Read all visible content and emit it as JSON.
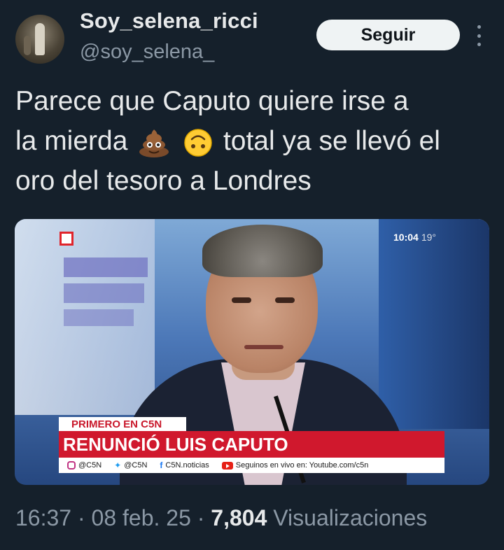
{
  "user": {
    "display_name": "Soy_selena_ricci",
    "handle": "@soy_selena_"
  },
  "follow_button_label": "Seguir",
  "tweet": {
    "line1": "Parece que Caputo quiere irse a",
    "line2_before": "la mierda",
    "line2_after": "total ya se llevó el",
    "line3": "oro del tesoro a Londres",
    "emojis": [
      "poop-emoji",
      "upside-down-face-emoji"
    ]
  },
  "media": {
    "clock_time": "10:04",
    "clock_temp": "19°",
    "banner_label": "PRIMERO EN C5N",
    "headline": "RENUNCIÓ LUIS CAPUTO",
    "social": {
      "instagram": "@C5N",
      "twitter": "@C5N",
      "facebook": "C5N.noticias",
      "youtube": "Seguinos en vivo en: Youtube.com/c5n"
    },
    "brand_color": "#d0182d"
  },
  "meta": {
    "time": "16:37",
    "separator1": " · ",
    "date": "08 feb. 25",
    "separator2": " · ",
    "views": "7,804",
    "views_label": "Visualizaciones"
  }
}
